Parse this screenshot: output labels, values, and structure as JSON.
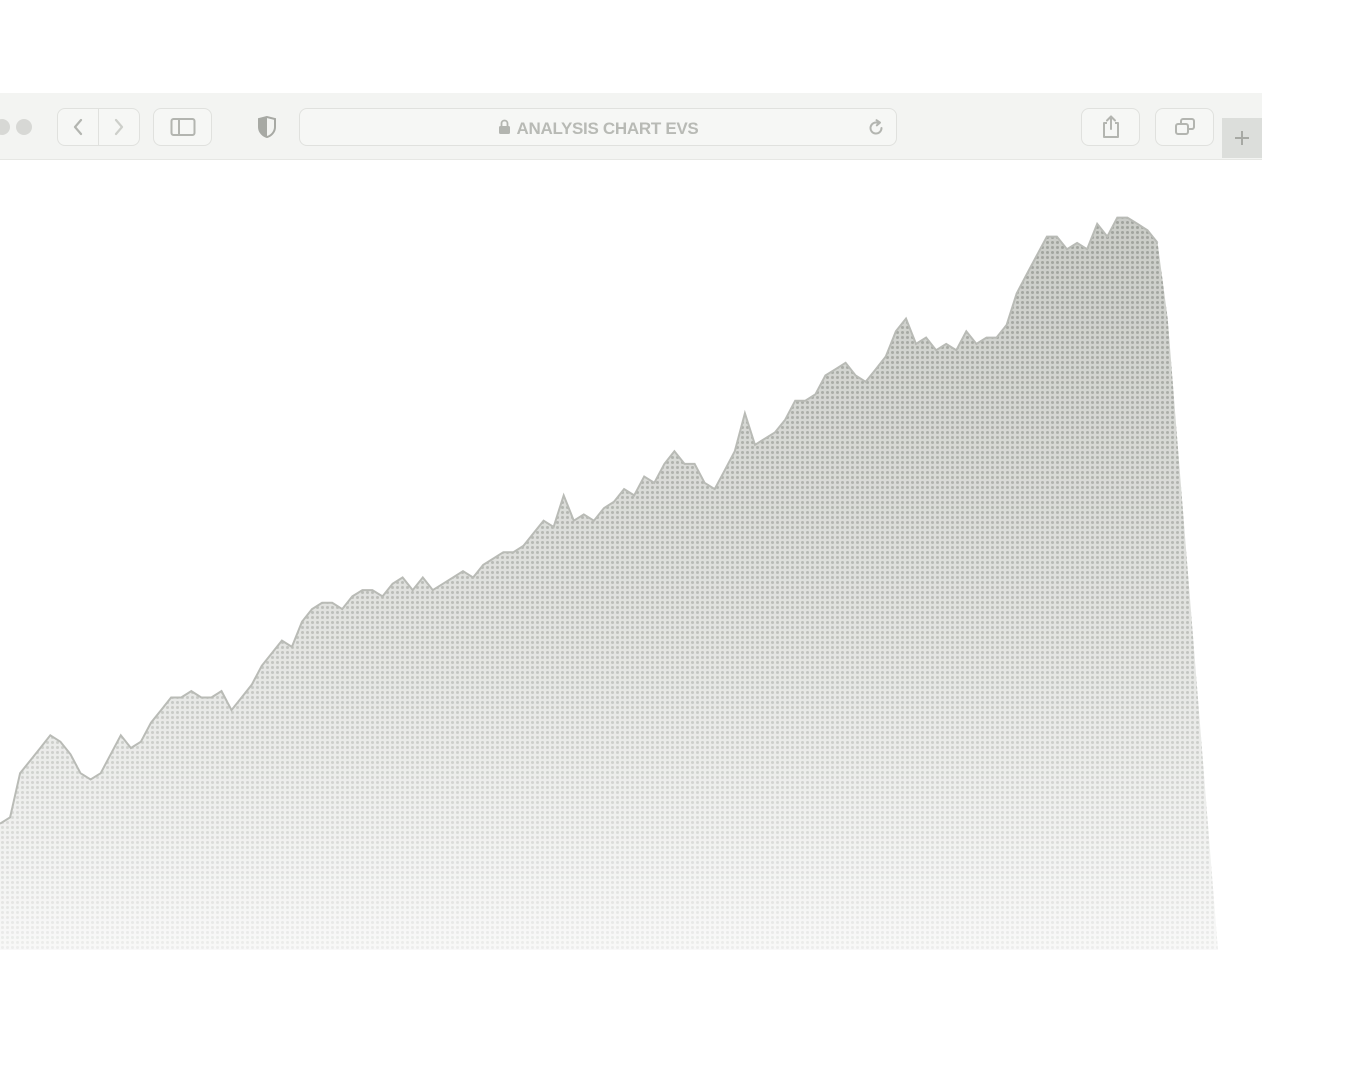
{
  "browser": {
    "address_text": "ANALYSIS CHART EVS",
    "icons": {
      "traffic_light": "traffic-light-dot",
      "back": "chevron-left-icon",
      "forward": "chevron-right-icon",
      "sidebar": "sidebar-icon",
      "privacy": "shield-icon",
      "lock": "lock-icon",
      "reload": "reload-icon",
      "share": "share-icon",
      "tabs": "tabs-overview-icon",
      "new_tab": "plus-icon"
    }
  },
  "chart_data": {
    "type": "area",
    "title": "",
    "xlabel": "",
    "ylabel": "",
    "x": [
      0,
      1,
      2,
      3,
      4,
      5,
      6,
      7,
      8,
      9,
      10,
      11,
      12,
      13,
      14,
      15,
      16,
      17,
      18,
      19,
      20,
      21,
      22,
      23,
      24,
      25,
      26,
      27,
      28,
      29,
      30,
      31,
      32,
      33,
      34,
      35,
      36,
      37,
      38,
      39,
      40,
      41,
      42,
      43,
      44,
      45,
      46,
      47,
      48,
      49,
      50,
      51,
      52,
      53,
      54,
      55,
      56,
      57,
      58,
      59,
      60,
      61,
      62,
      63,
      64,
      65,
      66,
      67,
      68,
      69,
      70,
      71,
      72,
      73,
      74,
      75,
      76,
      77,
      78,
      79,
      80,
      81,
      82,
      83,
      84,
      85,
      86,
      87,
      88,
      89,
      90,
      91,
      92,
      93,
      94,
      95,
      96,
      97,
      98,
      99,
      100,
      101,
      102,
      103,
      104,
      105,
      106,
      107,
      108,
      109,
      110,
      111,
      112,
      113,
      114,
      115,
      116,
      117,
      118,
      119,
      120,
      121
    ],
    "values": [
      20,
      21,
      28,
      30,
      32,
      34,
      33,
      31,
      28,
      27,
      28,
      31,
      34,
      32,
      33,
      36,
      38,
      40,
      40,
      41,
      40,
      40,
      41,
      38,
      40,
      42,
      45,
      47,
      49,
      48,
      52,
      54,
      55,
      55,
      54,
      56,
      57,
      57,
      56,
      58,
      59,
      57,
      59,
      57,
      58,
      59,
      60,
      59,
      61,
      62,
      63,
      63,
      64,
      66,
      68,
      67,
      72,
      68,
      69,
      68,
      70,
      71,
      73,
      72,
      75,
      74,
      77,
      79,
      77,
      77,
      74,
      73,
      76,
      79,
      85,
      80,
      81,
      82,
      84,
      87,
      87,
      88,
      91,
      92,
      93,
      91,
      90,
      92,
      94,
      98,
      100,
      96,
      97,
      95,
      96,
      95,
      98,
      96,
      97,
      97,
      99,
      104,
      107,
      110,
      113,
      113,
      111,
      112,
      111,
      115,
      113,
      116,
      116,
      115,
      114,
      112,
      100,
      80,
      60,
      40,
      20,
      0
    ],
    "ylim": [
      0,
      118
    ],
    "grid": false,
    "legend": "none",
    "fill": "#c9cbc6"
  }
}
